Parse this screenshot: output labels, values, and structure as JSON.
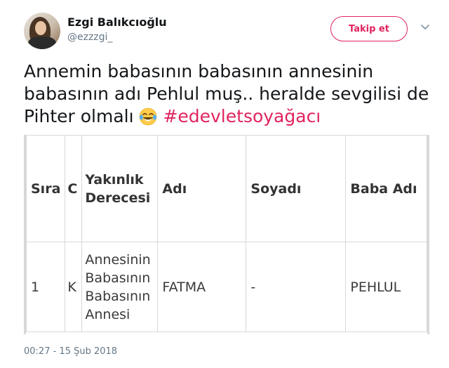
{
  "user": {
    "display_name": "Ezgi Balıkcıoğlu",
    "handle": "@ezzzgi_",
    "follow_label": "Takip et"
  },
  "tweet": {
    "text_line1": "Annemin babasının babasının annesinin",
    "text_line2": "babasının adı Pehlul muş.. heralde sevgilisi de",
    "text_line3": "Pihter olmalı",
    "hashtag": "#edevletsoyağacı",
    "emoji": "face-with-tears-of-joy-icon",
    "timestamp": "00:27 - 15 Şub 2018"
  },
  "table": {
    "headers": {
      "sira": "Sıra",
      "c": "C",
      "yakinlik_1": "Yakınlık",
      "yakinlik_2": "Derecesi",
      "adi": "Adı",
      "soyadi": "Soyadı",
      "baba_adi": "Baba Adı"
    },
    "row": {
      "sira": "1",
      "c": "K",
      "yakinlik_1": "Annesinin",
      "yakinlik_2": "Babasının",
      "yakinlik_3": "Babasının",
      "yakinlik_4": "Annesi",
      "adi": "FATMA",
      "soyadi": "-",
      "baba_adi": "PEHLUL"
    }
  },
  "colors": {
    "accent": "#e0245e",
    "text": "#14171a",
    "secondary": "#657786"
  }
}
